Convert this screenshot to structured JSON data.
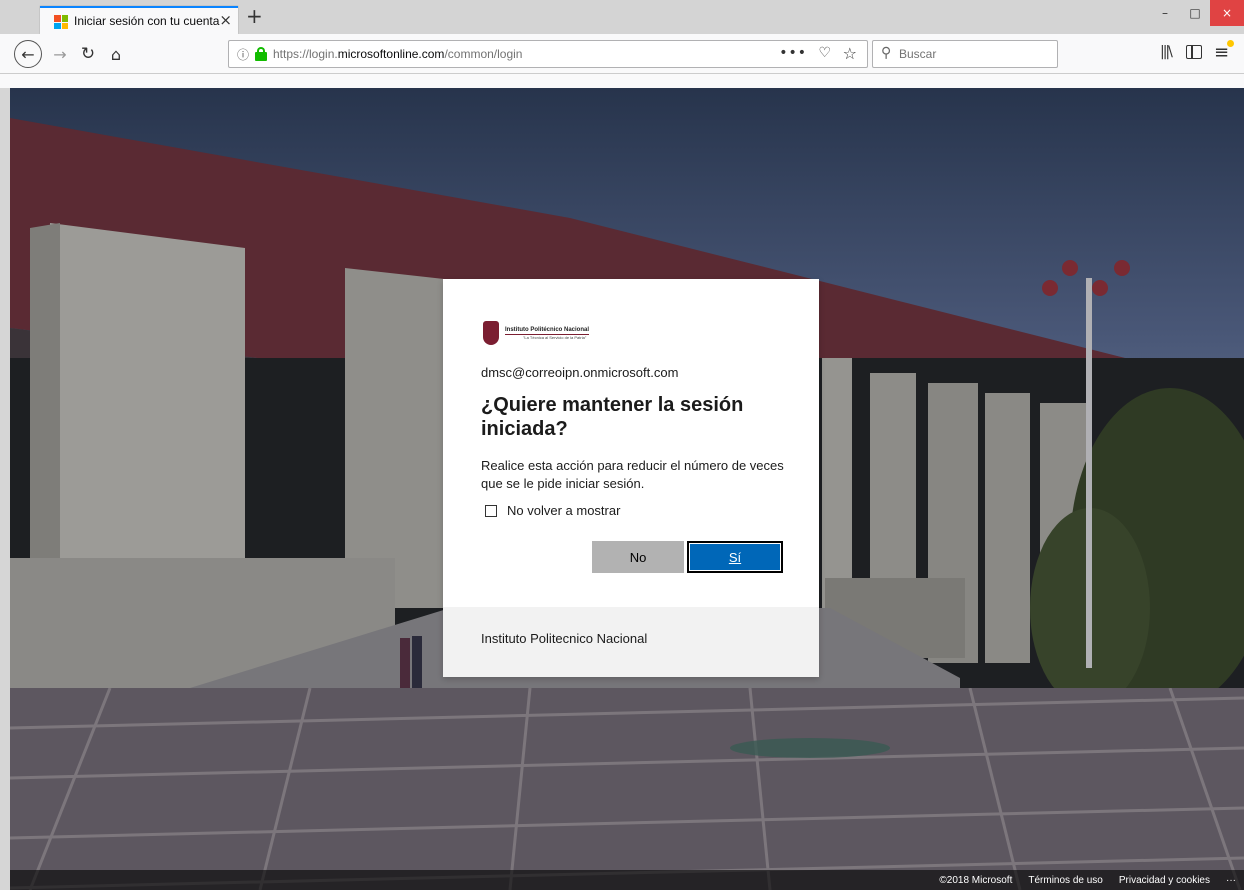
{
  "browser": {
    "tab_title": "Iniciar sesión con tu cuenta",
    "tab_close": "×",
    "new_tab": "+",
    "url_prefix": "https://login.",
    "url_domain": "microsoftonline.com",
    "url_path": "/common/login",
    "search_placeholder": "Buscar",
    "window_controls": {
      "minimize": "–",
      "maximize": "□",
      "close": "×"
    }
  },
  "dialog": {
    "logo_org": "Instituto Politécnico Nacional",
    "logo_motto": "\"La Técnica al Servicio de la Patria\"",
    "identity": "dmsc@correoipn.onmicrosoft.com",
    "heading": "¿Quiere mantener la sesión iniciada?",
    "description": "Realice esta acción para reducir el número de veces que se le pide iniciar sesión.",
    "checkbox_label": "No volver a mostrar",
    "button_no": "No",
    "button_yes": "Sí",
    "footer": "Instituto Politecnico Nacional"
  },
  "footer": {
    "copyright": "©2018 Microsoft",
    "terms": "Términos de uso",
    "privacy": "Privacidad y cookies",
    "more": "···"
  },
  "colors": {
    "accent": "#0067b8",
    "tab_accent": "#0a84ff",
    "lock_green": "#12bc00",
    "ipn_maroon": "#7b1e31"
  }
}
